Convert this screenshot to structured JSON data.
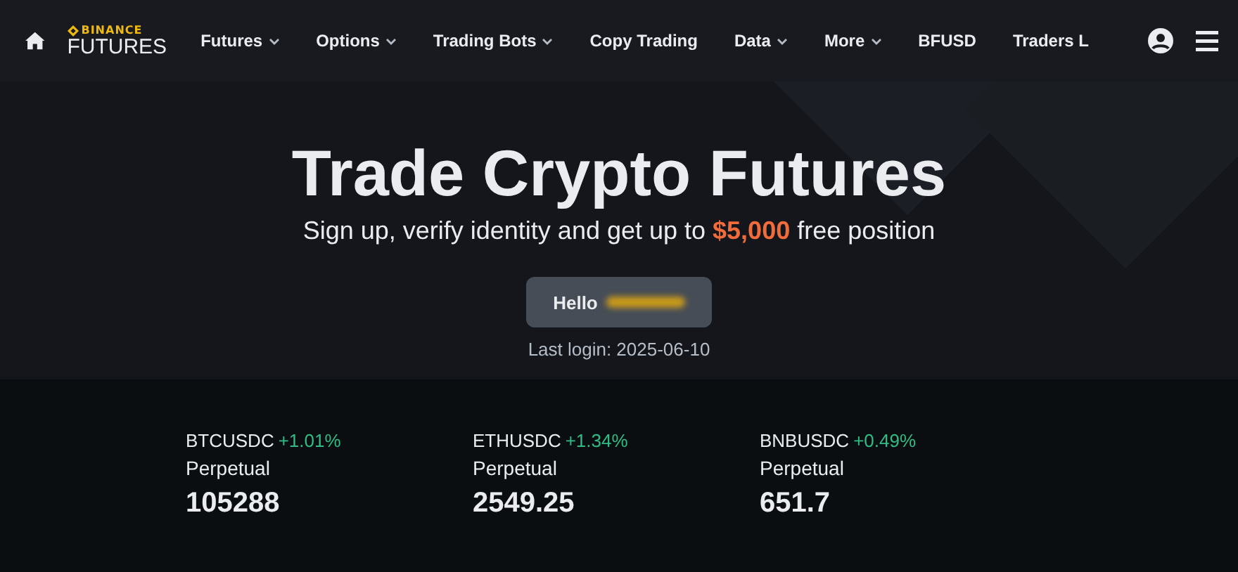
{
  "nav": {
    "logo": {
      "top": "BINANCE",
      "bottom": "FUTURES"
    },
    "items": [
      {
        "label": "Futures",
        "dropdown": true
      },
      {
        "label": "Options",
        "dropdown": true
      },
      {
        "label": "Trading Bots",
        "dropdown": true
      },
      {
        "label": "Copy Trading",
        "dropdown": false
      },
      {
        "label": "Data",
        "dropdown": true
      },
      {
        "label": "More",
        "dropdown": true
      },
      {
        "label": "BFUSD",
        "dropdown": false
      },
      {
        "label": "Traders L",
        "dropdown": false
      }
    ]
  },
  "hero": {
    "title": "Trade Crypto Futures",
    "subtitle": "Sign up, verify identity and get up to **$5,000** free position",
    "greeting": "Hello",
    "last_login": "Last login: 2025-06-10"
  },
  "tickers": [
    {
      "symbol": "BTCUSDC",
      "change": "+1.01%",
      "type": "Perpetual",
      "price": "105288"
    },
    {
      "symbol": "ETHUSDC",
      "change": "+1.34%",
      "type": "Perpetual",
      "price": "2549.25"
    },
    {
      "symbol": "BNBUSDC",
      "change": "+0.49%",
      "type": "Perpetual",
      "price": "651.7"
    }
  ]
}
